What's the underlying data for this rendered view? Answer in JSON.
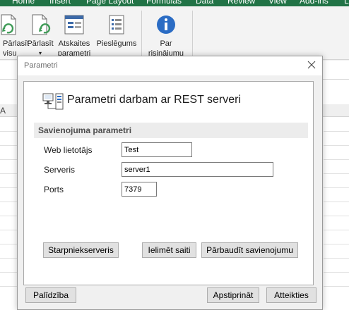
{
  "ribbon": {
    "tabs": [
      "Home",
      "Insert",
      "Page Layout",
      "Formulas",
      "Data",
      "Review",
      "View",
      "Add-ins",
      "L"
    ],
    "buttons": [
      {
        "line1": "Pārlasīt",
        "line2": "visu"
      },
      {
        "line1": "Pārlasīt",
        "line2": "▾"
      },
      {
        "line1": "Atskaites",
        "line2": "parametri"
      },
      {
        "line1": "Pieslēgums",
        "line2": ""
      },
      {
        "line1": "Par",
        "line2": "risinājumu"
      }
    ]
  },
  "sheet": {
    "column_letter": "A"
  },
  "dialog": {
    "title": "Parametri",
    "header": "Parametri darbam ar REST serveri",
    "section": "Savienojuma parametri",
    "fields": {
      "user_label": "Web lietotājs",
      "user_value": "Test",
      "server_label": "Serveris",
      "server_value": "server1",
      "port_label": "Ports",
      "port_value": "7379"
    },
    "buttons": {
      "proxy": "Starpniekserveris",
      "record_path": "Ielimēt saiti",
      "test_connection": "Pārbaudīt savienojumu",
      "help": "Palīdzība",
      "confirm": "Apstiprināt",
      "cancel": "Atteikties"
    }
  },
  "colors": {
    "excel_green": "#217346",
    "info_blue": "#2b6cc4"
  },
  "icons": [
    "refresh-all-icon",
    "refresh-icon",
    "report-params-icon",
    "connection-icon",
    "info-icon",
    "server-computer-icon",
    "close-icon"
  ]
}
